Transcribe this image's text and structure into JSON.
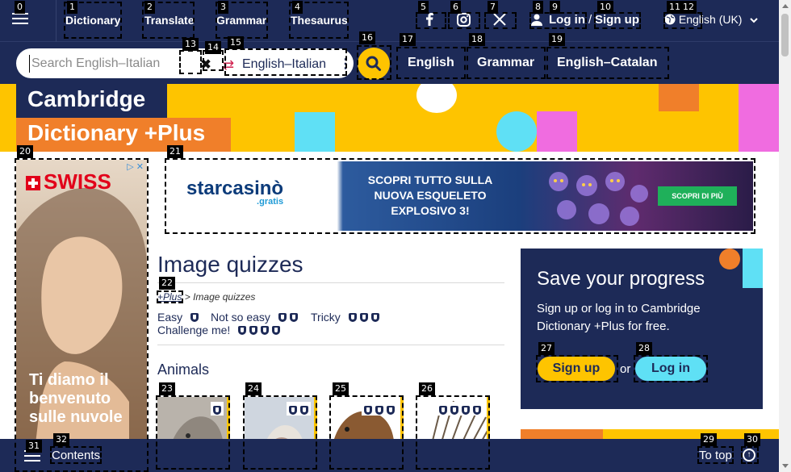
{
  "nav": {
    "links": [
      "Dictionary",
      "Translate",
      "Grammar",
      "Thesaurus"
    ],
    "login": "Log in",
    "separator": "/",
    "signup": "Sign up",
    "language": "English (UK)"
  },
  "search": {
    "placeholder": "Search English–Italian",
    "dictionary": "English–Italian",
    "quick_links": [
      "English",
      "Grammar",
      "English–Catalan"
    ]
  },
  "brand": {
    "line1": "Cambridge",
    "line2": "Dictionary +Plus"
  },
  "ads": {
    "left_brand": "SWISS",
    "left_text": "Ti diamo il benvenuto sulle nuvole",
    "top_brand": "starcasinò",
    "top_brand_sub": ".gratis",
    "top_text": "SCOPRI TUTTO SULLA NUOVA ESQUELETO EXPLOSIVO 3!",
    "top_cta": "SCOPRI DI PIÙ"
  },
  "main": {
    "title": "Image quizzes",
    "breadcrumb_link": "+Plus",
    "breadcrumb_sep": ">",
    "breadcrumb_current": "Image quizzes",
    "levels": [
      {
        "label": "Easy",
        "shields": 1
      },
      {
        "label": "Not so easy",
        "shields": 2
      },
      {
        "label": "Tricky",
        "shields": 3
      },
      {
        "label": "Challenge me!",
        "shields": 4
      }
    ],
    "category": "Animals",
    "quiz_shields": [
      1,
      2,
      3,
      4
    ]
  },
  "panel": {
    "title": "Save your progress",
    "text": "Sign up or log in to Cambridge Dictionary +Plus for free.",
    "signup": "Sign up",
    "or": "or",
    "login": "Log in"
  },
  "bottom": {
    "contents": "Contents",
    "to_top": "To top"
  },
  "annotations": [
    "0",
    "1",
    "2",
    "3",
    "4",
    "5",
    "6",
    "7",
    "8",
    "9",
    "10",
    "11",
    "12",
    "13",
    "14",
    "15",
    "16",
    "17",
    "18",
    "19",
    "20",
    "21",
    "22",
    "23",
    "24",
    "25",
    "26",
    "27",
    "28",
    "29",
    "30",
    "31",
    "32"
  ],
  "colors": {
    "navy": "#1d2a57",
    "yellow": "#fec400",
    "orange": "#f07f2a",
    "cyan": "#5fe0f5",
    "pink": "#f06ce0"
  }
}
